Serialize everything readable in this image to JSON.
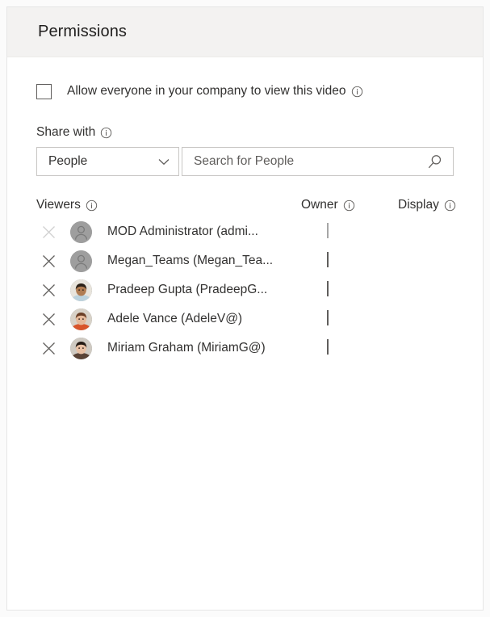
{
  "card": {
    "title": "Permissions"
  },
  "allow_everyone": {
    "label": "Allow everyone in your company to view this video",
    "checked": false,
    "info_icon": "info-icon"
  },
  "share_with": {
    "label": "Share with",
    "info_icon": "info-icon",
    "dropdown": {
      "selected": "People",
      "options": [
        "People"
      ],
      "chevron_icon": "chevron-down-icon"
    },
    "search": {
      "value": "",
      "placeholder": "Search for People",
      "icon": "search-icon"
    }
  },
  "viewers_table": {
    "headers": {
      "viewers": "Viewers",
      "owner": "Owner",
      "display": "Display"
    },
    "header_info_icon": "info-icon",
    "remove_icon": "close-icon",
    "rows": [
      {
        "name": "MOD Administrator (admi...",
        "avatar_type": "placeholder",
        "avatar_colors": {
          "bg": "#9e9e9e",
          "fg": "#7a7a7a"
        },
        "owner_checked": true,
        "owner_disabled": true,
        "remove_disabled": true
      },
      {
        "name": "Megan_Teams (Megan_Tea...",
        "avatar_type": "placeholder",
        "avatar_colors": {
          "bg": "#9e9e9e",
          "fg": "#7a7a7a"
        },
        "owner_checked": false,
        "owner_disabled": false,
        "remove_disabled": false
      },
      {
        "name": "Pradeep Gupta (PradeepG...",
        "avatar_type": "photo",
        "avatar_colors": {
          "bg": "#e8e4dc",
          "hair": "#2b2118",
          "skin": "#b07c52",
          "shirt": "#bcd2dd"
        },
        "owner_checked": false,
        "owner_disabled": false,
        "remove_disabled": false
      },
      {
        "name": "Adele Vance (AdeleV@)",
        "avatar_type": "photo",
        "avatar_colors": {
          "bg": "#d8d2c8",
          "hair": "#6b3f26",
          "skin": "#e5b99a",
          "shirt": "#d8552b"
        },
        "owner_checked": false,
        "owner_disabled": false,
        "remove_disabled": false
      },
      {
        "name": "Miriam Graham (MiriamG@)",
        "avatar_type": "photo",
        "avatar_colors": {
          "bg": "#cfcac2",
          "hair": "#241a14",
          "skin": "#e8c0a4",
          "shirt": "#5a4336"
        },
        "owner_checked": false,
        "owner_disabled": false,
        "remove_disabled": false
      }
    ]
  },
  "colors": {
    "header_band": "#f3f2f1",
    "card_border": "#e6e6e6",
    "text": "#323130",
    "title_text": "#201f1e",
    "input_border": "#c8c6c4",
    "checkbox_border": "#605e5c",
    "checked_disabled_fill": "#a6a6a6",
    "icon": "#605e5c",
    "icon_disabled": "#d0d0d0",
    "placeholder_text": "#605e5c"
  }
}
